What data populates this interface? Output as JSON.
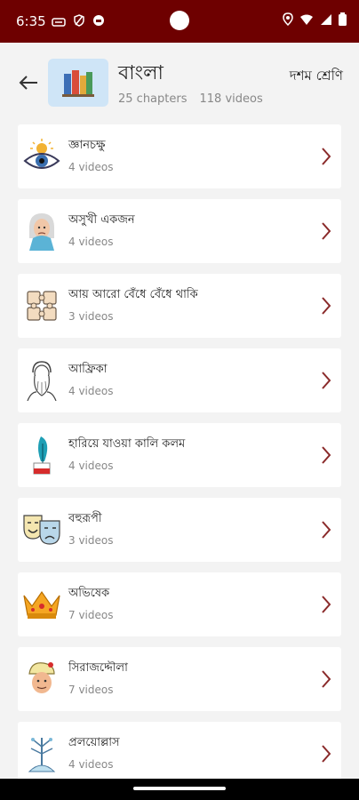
{
  "status": {
    "time": "6:35"
  },
  "header": {
    "title": "বাংলা",
    "chapters": "25 chapters",
    "videos": "118 videos",
    "class_label": "দশম শ্রেণি"
  },
  "colors": {
    "status_bar": "#6e0000",
    "chevron": "#8a2a2a",
    "thumb_bg": "#cfe5f7"
  },
  "chapters": [
    {
      "title": "জ্ঞানচক্ষু",
      "videos": "4 videos",
      "icon": "eye-icon"
    },
    {
      "title": "অসুখী একজন",
      "videos": "4 videos",
      "icon": "old-woman-icon"
    },
    {
      "title": "আয় আরো বেঁধে বেঁধে থাকি",
      "videos": "3 videos",
      "icon": "puzzle-icon"
    },
    {
      "title": "আফ্রিকা",
      "videos": "4 videos",
      "icon": "bearded-man-icon"
    },
    {
      "title": "হারিয়ে যাওয়া কালি কলম",
      "videos": "4 videos",
      "icon": "quill-ink-icon"
    },
    {
      "title": "বহুরূপী",
      "videos": "3 videos",
      "icon": "theater-masks-icon"
    },
    {
      "title": "অভিষেক",
      "videos": "7 videos",
      "icon": "crown-icon"
    },
    {
      "title": "সিরাজদ্দৌলা",
      "videos": "7 videos",
      "icon": "nawab-icon"
    },
    {
      "title": "প্রলয়োল্লাস",
      "videos": "4 videos",
      "icon": "cosmic-tree-icon"
    }
  ]
}
